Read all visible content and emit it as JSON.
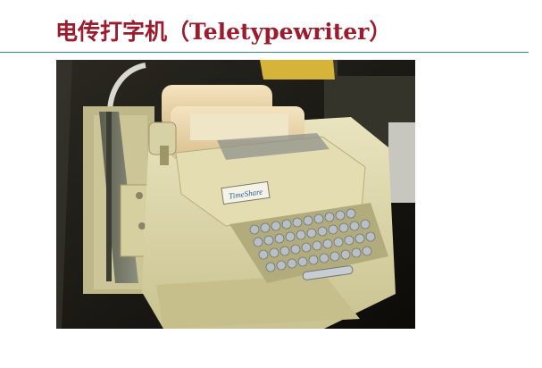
{
  "slide": {
    "title": "电传打字机（Teletypewriter）"
  },
  "photo": {
    "brand_label": "TimeShare",
    "colors": {
      "title": "#9b1c2e",
      "rule": "#2f8a7a",
      "machine_body": "#ddd7a8",
      "key_cap": "#b9c0c4",
      "paper_roll": "#ecd8b0"
    }
  }
}
